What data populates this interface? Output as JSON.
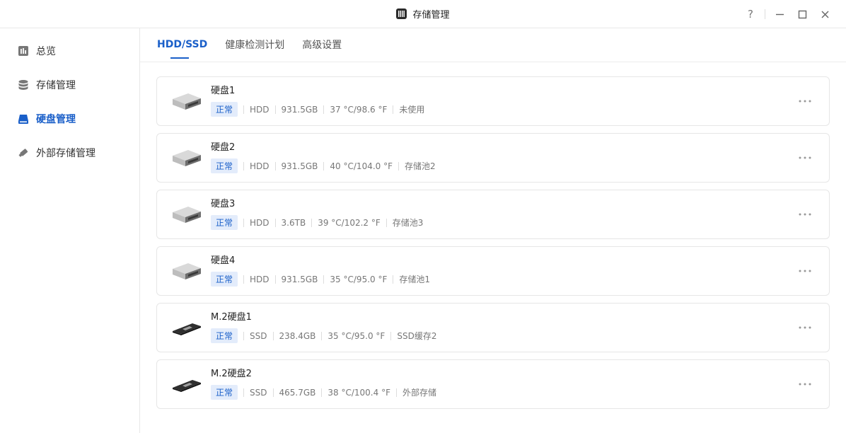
{
  "window": {
    "title": "存储管理",
    "help_label": "?",
    "app_icon": "storage-app-icon"
  },
  "sidebar": {
    "items": [
      {
        "label": "总览",
        "icon": "overview-icon"
      },
      {
        "label": "存储管理",
        "icon": "database-icon"
      },
      {
        "label": "硬盘管理",
        "icon": "disk-icon",
        "active": true
      },
      {
        "label": "外部存储管理",
        "icon": "usb-drive-icon"
      }
    ]
  },
  "tabs": [
    {
      "label": "HDD/SSD",
      "active": true
    },
    {
      "label": "健康检测计划"
    },
    {
      "label": "高级设置"
    }
  ],
  "disks": [
    {
      "name": "硬盘1",
      "status": "正常",
      "type": "HDD",
      "size": "931.5GB",
      "temp": "37 °C/98.6 °F",
      "usage": "未使用",
      "kind": "hdd"
    },
    {
      "name": "硬盘2",
      "status": "正常",
      "type": "HDD",
      "size": "931.5GB",
      "temp": "40 °C/104.0 °F",
      "usage": "存储池2",
      "kind": "hdd"
    },
    {
      "name": "硬盘3",
      "status": "正常",
      "type": "HDD",
      "size": "3.6TB",
      "temp": "39 °C/102.2 °F",
      "usage": "存储池3",
      "kind": "hdd"
    },
    {
      "name": "硬盘4",
      "status": "正常",
      "type": "HDD",
      "size": "931.5GB",
      "temp": "35 °C/95.0 °F",
      "usage": "存储池1",
      "kind": "hdd"
    },
    {
      "name": "M.2硬盘1",
      "status": "正常",
      "type": "SSD",
      "size": "238.4GB",
      "temp": "35 °C/95.0 °F",
      "usage": "SSD缓存2",
      "kind": "ssd"
    },
    {
      "name": "M.2硬盘2",
      "status": "正常",
      "type": "SSD",
      "size": "465.7GB",
      "temp": "38 °C/100.4 °F",
      "usage": "外部存储",
      "kind": "ssd"
    }
  ],
  "colors": {
    "accent": "#1a5fc9",
    "badge_bg": "#e3ecfb"
  }
}
